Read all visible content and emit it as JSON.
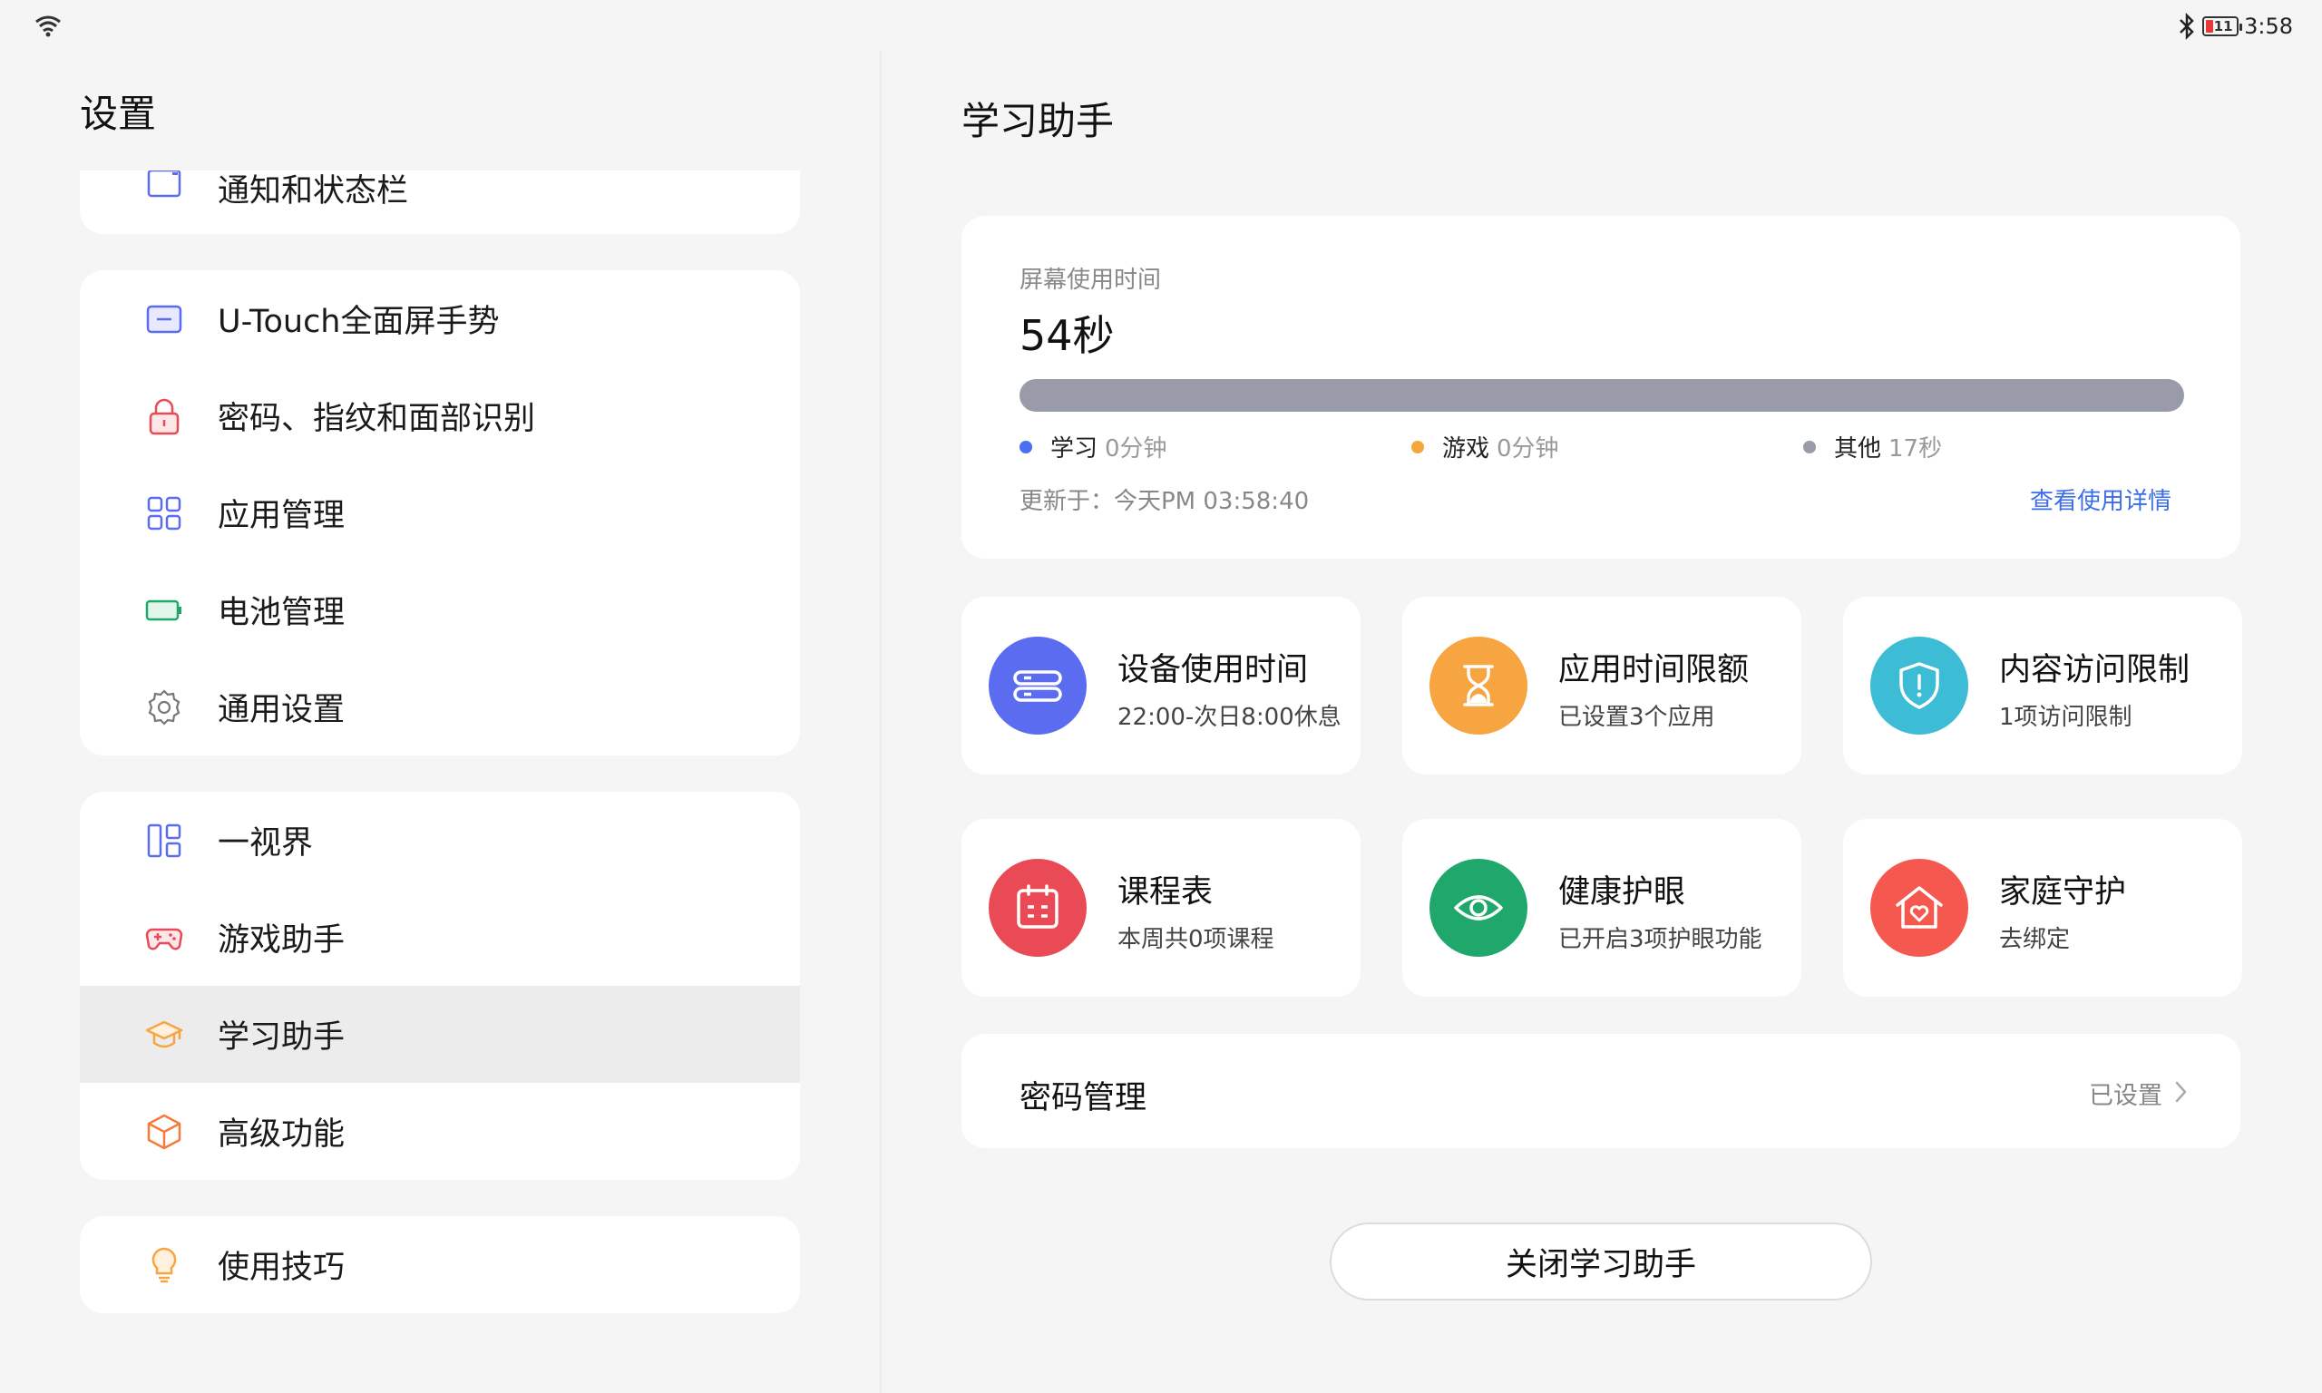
{
  "status": {
    "time": "3:58",
    "battery_level": "11"
  },
  "sidebar": {
    "title": "设置",
    "items": [
      {
        "label": "通知和状态栏",
        "icon": "notification-bar-icon"
      },
      {
        "label": "U-Touch全面屏手势",
        "icon": "gesture-icon"
      },
      {
        "label": "密码、指纹和面部识别",
        "icon": "lock-icon"
      },
      {
        "label": "应用管理",
        "icon": "apps-grid-icon"
      },
      {
        "label": "电池管理",
        "icon": "battery-icon"
      },
      {
        "label": "通用设置",
        "icon": "gear-icon"
      },
      {
        "label": "一视界",
        "icon": "layout-icon"
      },
      {
        "label": "游戏助手",
        "icon": "gamepad-icon"
      },
      {
        "label": "学习助手",
        "icon": "graduation-cap-icon",
        "active": true
      },
      {
        "label": "高级功能",
        "icon": "cube-icon"
      },
      {
        "label": "使用技巧",
        "icon": "lightbulb-icon"
      }
    ]
  },
  "main": {
    "title": "学习助手",
    "usage": {
      "label": "屏幕使用时间",
      "value": "54秒",
      "legend": [
        {
          "name": "学习",
          "value": "0分钟",
          "color": "#4b6ef5"
        },
        {
          "name": "游戏",
          "value": "0分钟",
          "color": "#f5a63a"
        },
        {
          "name": "其他",
          "value": "17秒",
          "color": "#9a9ba8"
        }
      ],
      "bar_fraction": {
        "study": 0,
        "game": 0,
        "other": 1
      },
      "updated": "更新于：今天PM 03:58:40",
      "details_link": "查看使用详情"
    },
    "features": [
      {
        "title": "设备使用时间",
        "subtitle": "22:00-次日8:00休息",
        "color": "#5b6cf0",
        "icon": "device-time-icon"
      },
      {
        "title": "应用时间限额",
        "subtitle": "已设置3个应用",
        "color": "#f7a540",
        "icon": "hourglass-icon"
      },
      {
        "title": "内容访问限制",
        "subtitle": "1项访问限制",
        "color": "#3dbcd6",
        "icon": "shield-icon"
      },
      {
        "title": "课程表",
        "subtitle": "本周共0项课程",
        "color": "#ea4a55",
        "icon": "calendar-icon"
      },
      {
        "title": "健康护眼",
        "subtitle": "已开启3项护眼功能",
        "color": "#20a76b",
        "icon": "eye-icon"
      },
      {
        "title": "家庭守护",
        "subtitle": "去绑定",
        "color": "#f5584f",
        "icon": "home-heart-icon"
      }
    ],
    "password": {
      "label": "密码管理",
      "status": "已设置"
    },
    "close_button": "关闭学习助手"
  }
}
